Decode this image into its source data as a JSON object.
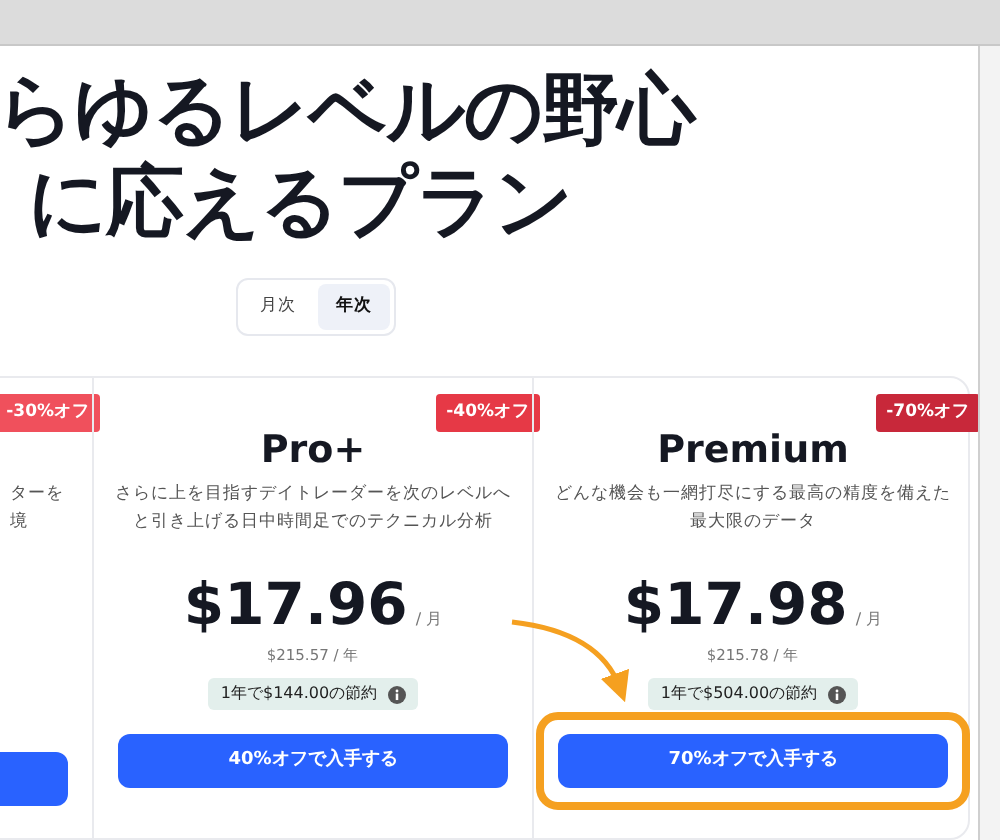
{
  "heading": [
    "らゆるレベルの野心",
    "に応えるプラン"
  ],
  "billing_toggle": [
    {
      "label": "月次",
      "selected": false
    },
    {
      "label": "年次",
      "selected": true
    }
  ],
  "plans": [
    {
      "kind": "partial",
      "badge": {
        "text": "-30%オフ",
        "color": "#f0505c"
      },
      "description_lines": [
        "ターを",
        "境"
      ],
      "highlighted": false
    },
    {
      "kind": "full",
      "name": "Pro+",
      "badge": {
        "text": "-40%オフ",
        "color": "#e63946"
      },
      "description_lines": [
        "さらに上を目指すデイトレーダーを次のレベルへ",
        "と引き上げる日中時間足でのテクニカル分析"
      ],
      "price": "$17.96",
      "per": "/ 月",
      "yearly": "$215.57 / 年",
      "savings": "1年で$144.00の節約",
      "button": "40%オフで入手する",
      "highlighted": false
    },
    {
      "kind": "full",
      "name": "Premium",
      "badge": {
        "text": "-70%オフ",
        "color": "#c8283a"
      },
      "description_lines": [
        "どんな機会も一網打尽にする最高の精度を備えた",
        "最大限のデータ"
      ],
      "price": "$17.98",
      "per": "/ 月",
      "yearly": "$215.78 / 年",
      "savings": "1年で$504.00の節約",
      "button": "70%オフで入手する",
      "highlighted": true
    }
  ]
}
